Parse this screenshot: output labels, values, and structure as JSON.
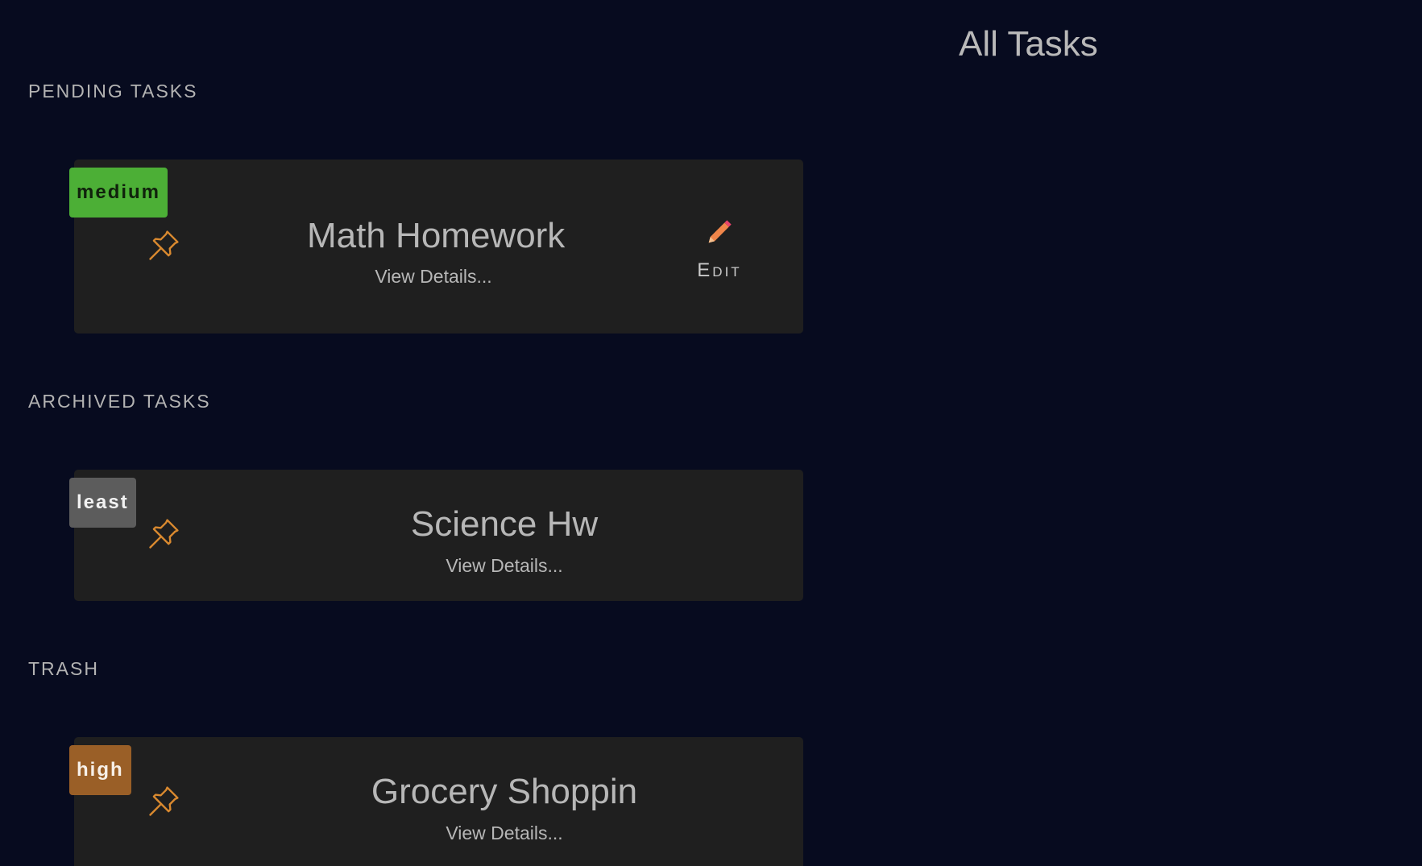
{
  "header": {
    "title": "All Tasks"
  },
  "sections": [
    {
      "heading": "PENDING TASKS",
      "task": {
        "priority": "medium",
        "title": "Math Homework",
        "details_link": "View Details...",
        "edit_label": "Edit"
      }
    },
    {
      "heading": "ARCHIVED TASKS",
      "task": {
        "priority": "least",
        "title": "Science Hw",
        "details_link": "View Details..."
      }
    },
    {
      "heading": "TRASH",
      "task": {
        "priority": "high",
        "title": "Grocery Shoppin",
        "details_link": "View Details..."
      }
    }
  ],
  "colors": {
    "background": "#070b1f",
    "card": "#1f1f1f",
    "priority_medium": "#4caf36",
    "priority_least": "#5c5c5c",
    "priority_high": "#9a5f27",
    "pin": "#d9892f",
    "edit_icon": "#f0864a"
  },
  "icons": {
    "pin": "pushpin-icon",
    "edit": "pencil-icon"
  }
}
